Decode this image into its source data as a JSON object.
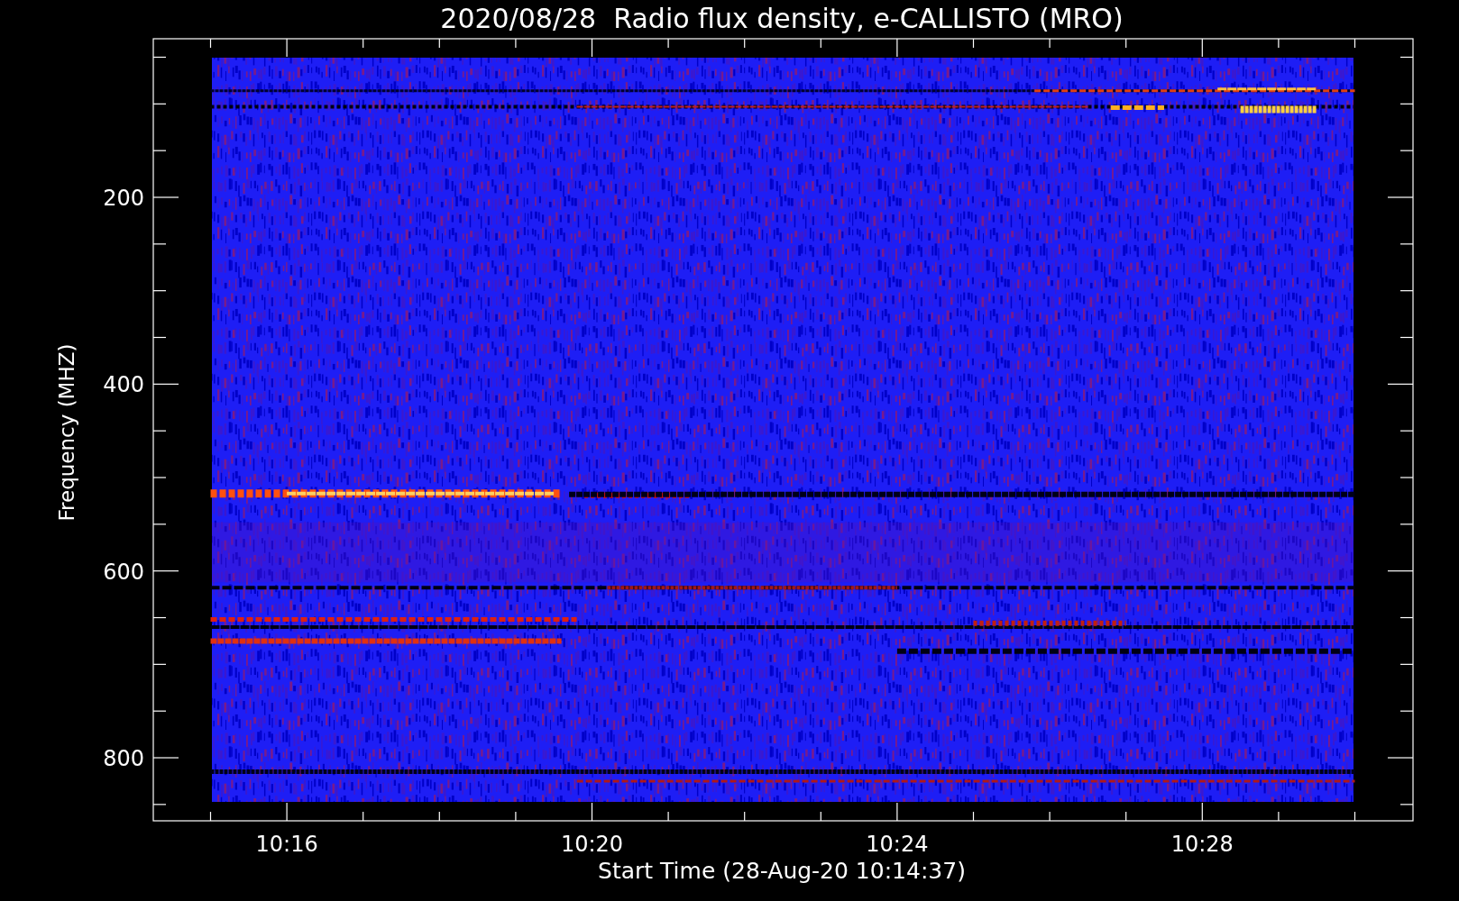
{
  "title": "2020/08/28  Radio flux density, e-CALLISTO (MRO)",
  "plot": {
    "xlabel": "Start Time (28-Aug-20 10:14:37)",
    "ylabel": "Frequency (MHZ)",
    "x_tick_labels": [
      "10:16",
      "10:20",
      "10:24",
      "10:28"
    ],
    "y_tick_labels": [
      "200",
      "400",
      "600",
      "800"
    ]
  }
}
